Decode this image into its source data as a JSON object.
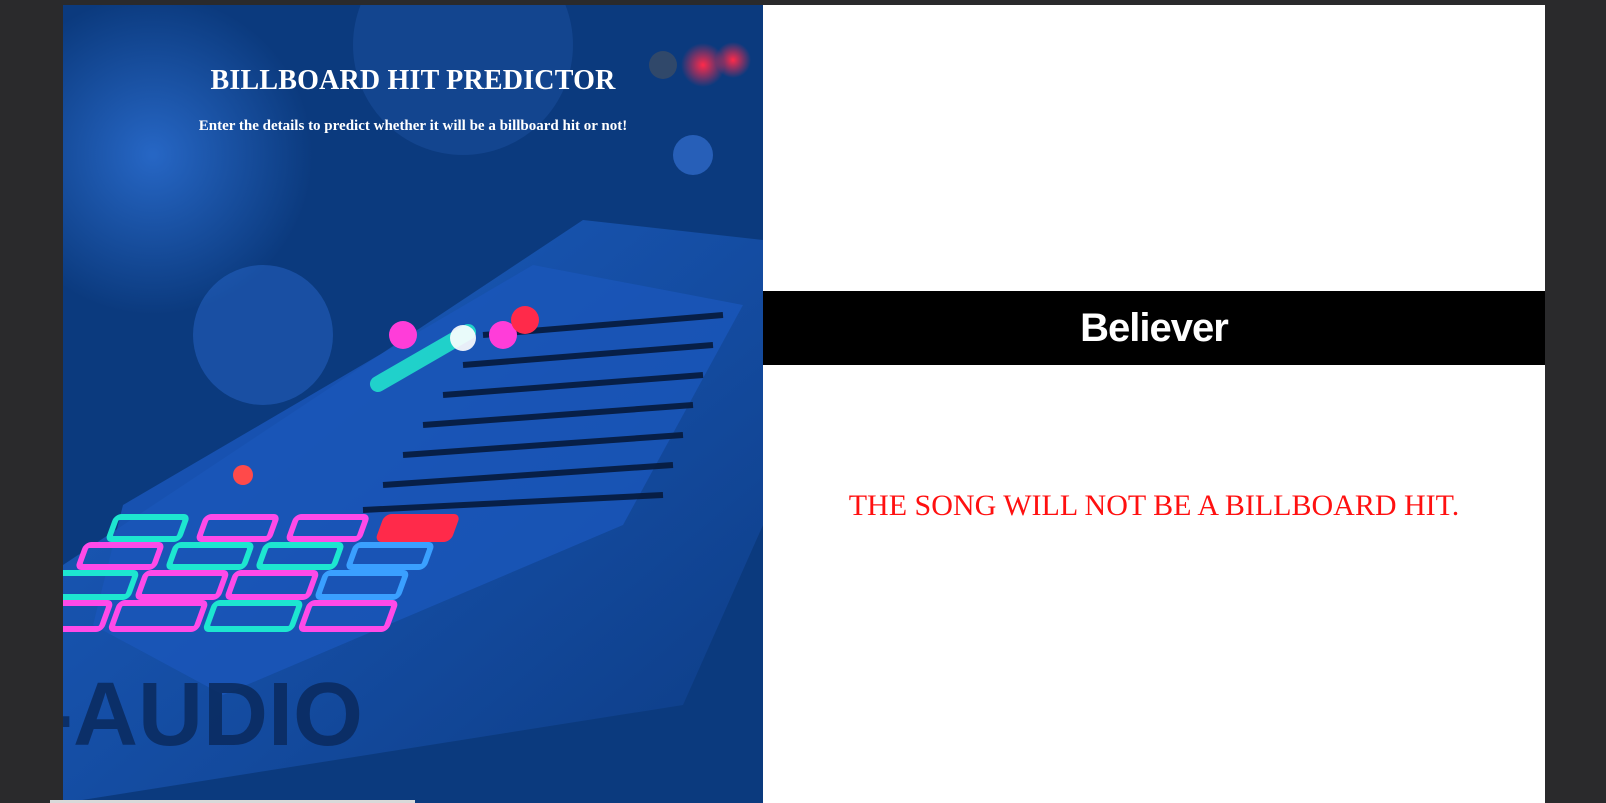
{
  "hero": {
    "title": "BILLBOARD HIT PREDICTOR",
    "subtitle": "Enter the details to predict whether it will be a billboard hit or not!",
    "background_image_icon": "midi-controller-photo"
  },
  "result": {
    "song_name": "Believer",
    "prediction": "THE SONG WILL NOT BE A BILLBOARD HIT.",
    "prediction_color": "#ff1010"
  },
  "colors": {
    "page_background": "#2a2a2c",
    "hero_background": "#0a3a7a",
    "banner_background": "#000000"
  }
}
